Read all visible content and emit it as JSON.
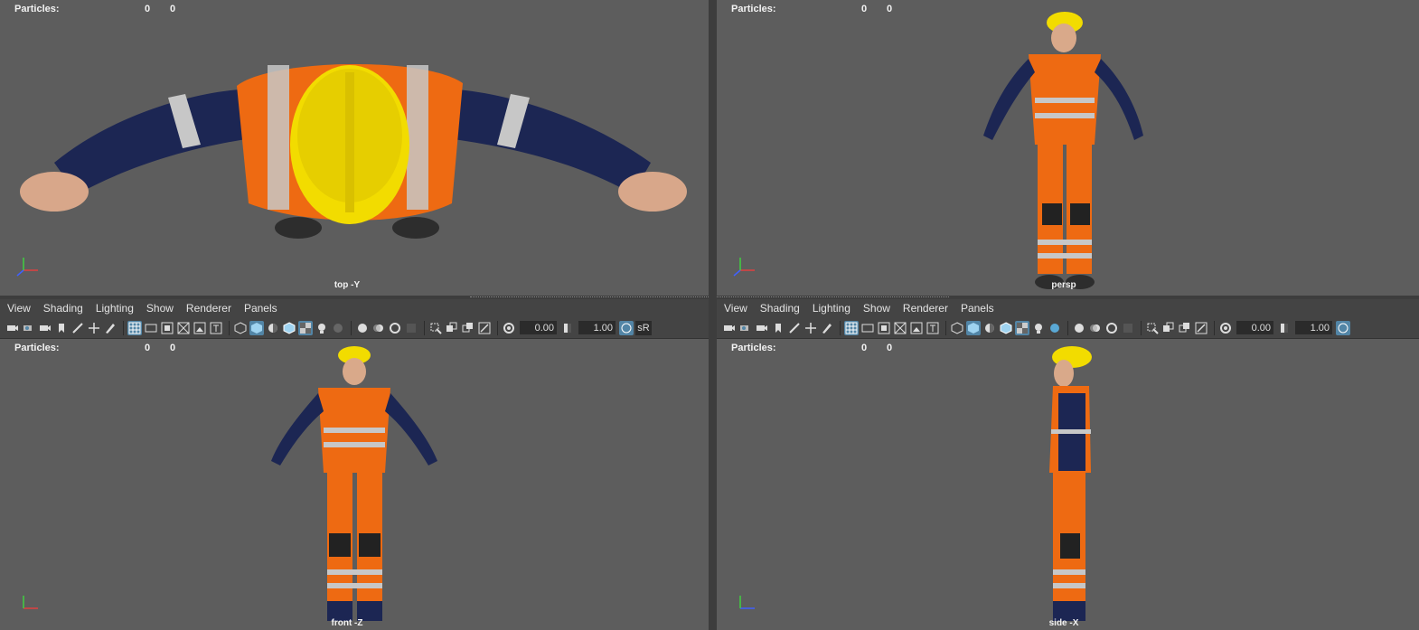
{
  "hud": {
    "label": "Particles:",
    "val1": "0",
    "val2": "0"
  },
  "viewports": {
    "top": {
      "camera": "top -Y"
    },
    "persp": {
      "camera": "persp"
    },
    "front": {
      "camera": "front -Z"
    },
    "side": {
      "camera": "side -X"
    }
  },
  "menu": {
    "view": "View",
    "shading": "Shading",
    "lighting": "Lighting",
    "show": "Show",
    "renderer": "Renderer",
    "panels": "Panels"
  },
  "toolbar": {
    "exposure": "0.00",
    "gamma": "1.00",
    "colorspace": "sR"
  },
  "axes": {
    "x": "x",
    "y": "y",
    "z": "z"
  },
  "colors": {
    "viewport_bg": "#5d5d5d",
    "panel_bg": "#444444",
    "accent": "#5285a6",
    "hardhat": "#f2dc00",
    "vest": "#ee6a12",
    "suit": "#1c2653",
    "reflective": "#c7c7c7"
  }
}
